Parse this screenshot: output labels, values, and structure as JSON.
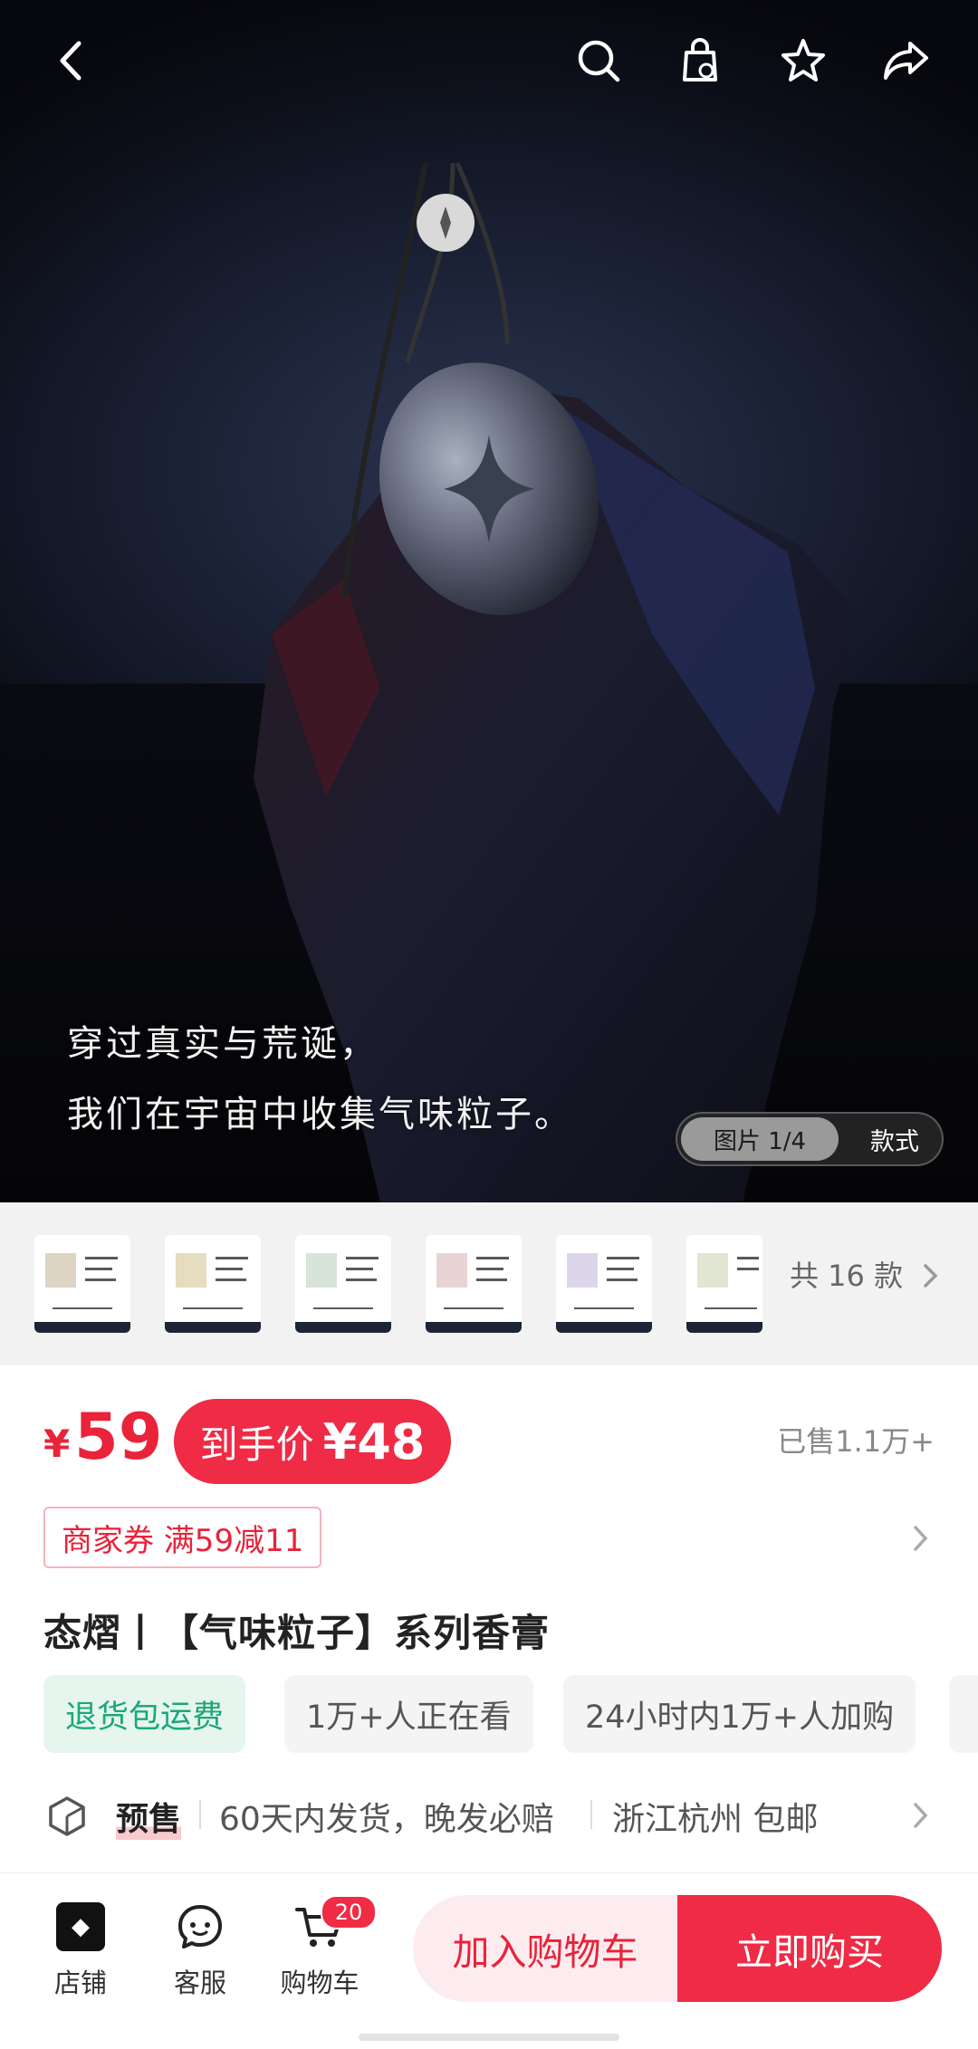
{
  "hero": {
    "caption_line1": "穿过真实与荒诞，",
    "caption_line2": "我们在宇宙中收集气味粒子。",
    "pager_label": "图片 1/4",
    "style_label": "款式"
  },
  "top_actions": [
    "back-icon",
    "search-icon",
    "shopping-bag-icon",
    "star-icon",
    "share-icon"
  ],
  "variants": {
    "count": 6,
    "more_label": "共 16 款"
  },
  "price": {
    "currency": "¥",
    "value": "59",
    "final_label": "到手价",
    "final_value": "¥48",
    "sold": "已售1.1万+"
  },
  "coupon": "商家券 满59减11",
  "title": "态熠丨【气味粒子】系列香膏",
  "tags": [
    {
      "text": "退货包运费"
    },
    {
      "text": "1万+人正在看"
    },
    {
      "text": "24小时内1万+人加购"
    }
  ],
  "shipping": {
    "presale": "预售",
    "delivery": "60天内发货，晚发必赔",
    "location": "浙江杭州 包邮"
  },
  "bottom": {
    "shop": "店铺",
    "service": "客服",
    "cart": "购物车",
    "cart_count": "20",
    "add_to_cart": "加入购物车",
    "buy_now": "立即购买"
  },
  "colors": {
    "accent": "#ef2b45",
    "price": "#e8233a",
    "tag_green": "#1aa877"
  }
}
